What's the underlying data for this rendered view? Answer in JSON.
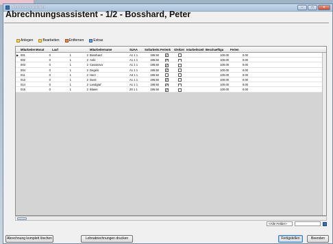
{
  "window": {
    "title": "Abrechnungsassistent",
    "heading": "Abrechnungsassistent - 1/2 - Bosshard, Peter",
    "btn_min": "–",
    "btn_max": "□",
    "btn_close": "✕"
  },
  "toolbar": {
    "add_label": "Anlegen",
    "edit_label": "Bearbeiten",
    "remove_label": "Entfernen",
    "extras_label": "Extras"
  },
  "table": {
    "columns": [
      "",
      "Mitarbeiter Jahr",
      "Monat",
      "Lauf",
      "",
      "Mitarbeitername",
      "SUAA",
      "Sollarbeitszei",
      "Ferienk",
      "Gleitzei",
      "Istarbeitszeit",
      "Beschaeftigu",
      "Ferien"
    ],
    "rows": [
      {
        "ptr": "▶",
        "id": "001",
        "jahr": "0",
        "monat": "1",
        "lauf": "2",
        "name": "Bosshard",
        "suaa": "A1 1 1",
        "soll": "195.50",
        "ferienk": true,
        "gleit": false,
        "ist": "",
        "besch": "100.00",
        "ferien": "0.00"
      },
      {
        "ptr": "",
        "id": "002",
        "jahr": "0",
        "monat": "1",
        "lauf": "2",
        "name": "Aebi",
        "suaa": "A1 1 1",
        "soll": "195.50",
        "ferienk": true,
        "gleit": false,
        "ist": "",
        "besch": "100.00",
        "ferien": "0.00"
      },
      {
        "ptr": "",
        "id": "003",
        "jahr": "0",
        "monat": "1",
        "lauf": "2",
        "name": "Casanova",
        "suaa": "A1 1 1",
        "soll": "195.50",
        "ferienk": true,
        "gleit": false,
        "ist": "",
        "besch": "100.00",
        "ferien": "0.00"
      },
      {
        "ptr": "",
        "id": "004",
        "jahr": "0",
        "monat": "1",
        "lauf": "2",
        "name": "Degelo",
        "suaa": "A1 1 1",
        "soll": "195.50",
        "ferienk": true,
        "gleit": false,
        "ist": "",
        "besch": "100.00",
        "ferien": "0.00"
      },
      {
        "ptr": "",
        "id": "011",
        "jahr": "0",
        "monat": "1",
        "lauf": "2",
        "name": "Herz",
        "suaa": "A3 1 1",
        "soll": "195.50",
        "ferienk": false,
        "gleit": false,
        "ist": "",
        "besch": "100.00",
        "ferien": "0.00"
      },
      {
        "ptr": "",
        "id": "013",
        "jahr": "0",
        "monat": "1",
        "lauf": "2",
        "name": "Duss",
        "suaa": "A1 1 1",
        "soll": "195.50",
        "ferienk": true,
        "gleit": false,
        "ist": "",
        "besch": "100.00",
        "ferien": "0.00"
      },
      {
        "ptr": "",
        "id": "014",
        "jahr": "0",
        "monat": "1",
        "lauf": "2",
        "name": "Landgraf",
        "suaa": "A1 1 1",
        "soll": "195.50",
        "ferienk": true,
        "gleit": false,
        "ist": "",
        "besch": "100.00",
        "ferien": "0.00"
      },
      {
        "ptr": "",
        "id": "015",
        "jahr": "0",
        "monat": "1",
        "lauf": "2",
        "name": "Blaser",
        "suaa": "Z0 1 1",
        "soll": "195.50",
        "ferienk": true,
        "gleit": false,
        "ist": "",
        "besch": "100.00",
        "ferien": "0.00"
      }
    ]
  },
  "filter": {
    "select_value": "<Alle Felder>"
  },
  "buttons": {
    "delete_all": "Abrechnung komplett löschen",
    "print": "Lohnabrechnungen drucken",
    "finish": "Fertigstellen",
    "close": "Beenden"
  }
}
